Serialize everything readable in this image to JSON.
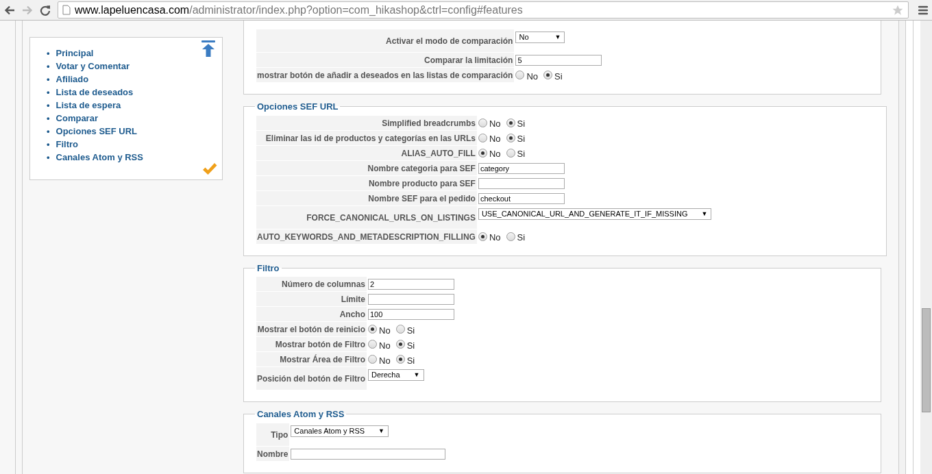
{
  "browser": {
    "url_host": "www.lapeluencasa.com",
    "url_path": "/administrator/index.php?option=com_hikashop&ctrl=config#features"
  },
  "sidebar": {
    "bullet": "•",
    "items": [
      {
        "label": "Principal"
      },
      {
        "label": "Votar y Comentar"
      },
      {
        "label": "Afiliado"
      },
      {
        "label": "Lista de deseados"
      },
      {
        "label": "Lista de espera"
      },
      {
        "label": "Comparar"
      },
      {
        "label": "Opciones SEF URL"
      },
      {
        "label": "Filtro"
      },
      {
        "label": "Canales Atom y RSS"
      }
    ]
  },
  "sections": [
    {
      "rows": [
        {
          "label": "Activar el modo de comparación",
          "kind": "select",
          "value": "No",
          "arrow": "▼"
        },
        {
          "label": "Comparar la limitación",
          "kind": "text",
          "value": "5"
        },
        {
          "label": "mostrar botón de añadir a deseados en las listas de comparación",
          "kind": "radio",
          "options": [
            {
              "label": "No",
              "selected": false
            },
            {
              "label": "Si",
              "selected": true
            }
          ]
        }
      ]
    },
    {
      "title": "Opciones SEF URL",
      "rows": [
        {
          "label": "Simplified breadcrumbs",
          "kind": "radio",
          "options": [
            {
              "label": "No",
              "selected": false
            },
            {
              "label": "Si",
              "selected": true
            }
          ]
        },
        {
          "label": "Eliminar las id de productos y categorías en las URLs",
          "kind": "radio",
          "options": [
            {
              "label": "No",
              "selected": false
            },
            {
              "label": "Si",
              "selected": true
            }
          ]
        },
        {
          "label": "ALIAS_AUTO_FILL",
          "kind": "radio",
          "options": [
            {
              "label": "No",
              "selected": true
            },
            {
              "label": "Si",
              "selected": false
            }
          ]
        },
        {
          "label": "Nombre categoria para SEF",
          "kind": "text",
          "value": "category"
        },
        {
          "label": "Nombre producto para SEF",
          "kind": "text"
        },
        {
          "label": "Nombre SEF para el pedido",
          "kind": "text",
          "value": "checkout"
        },
        {
          "label": "FORCE_CANONICAL_URLS_ON_LISTINGS",
          "kind": "select",
          "value": "USE_CANONICAL_URL_AND_GENERATE_IT_IF_MISSING",
          "arrow": "▼"
        },
        {
          "label": "AUTO_KEYWORDS_AND_METADESCRIPTION_FILLING",
          "kind": "radio",
          "options": [
            {
              "label": "No",
              "selected": true
            },
            {
              "label": "Si",
              "selected": false
            }
          ]
        }
      ]
    },
    {
      "title": "Filtro",
      "rows": [
        {
          "label": "Número de columnas",
          "kind": "text",
          "value": "2"
        },
        {
          "label": "Límite",
          "kind": "text"
        },
        {
          "label": "Ancho",
          "kind": "text",
          "value": "100"
        },
        {
          "label": "Mostrar el botón de reinicio",
          "kind": "radio",
          "options": [
            {
              "label": "No",
              "selected": true
            },
            {
              "label": "Si",
              "selected": false
            }
          ]
        },
        {
          "label": "Mostrar botón de Filtro",
          "kind": "radio",
          "options": [
            {
              "label": "No",
              "selected": false
            },
            {
              "label": "Si",
              "selected": true
            }
          ]
        },
        {
          "label": "Mostrar Área de Filtro",
          "kind": "radio",
          "options": [
            {
              "label": "No",
              "selected": false
            },
            {
              "label": "Si",
              "selected": true
            }
          ]
        },
        {
          "label": "Posición del botón de Filtro",
          "kind": "select",
          "value": "Derecha",
          "arrow": "▼"
        }
      ]
    },
    {
      "title": "Canales Atom y RSS",
      "rows": [
        {
          "label": "Tipo",
          "kind": "select",
          "value": "Canales Atom y RSS",
          "arrow": "▼"
        },
        {
          "label": "Nombre",
          "kind": "text"
        }
      ]
    }
  ]
}
